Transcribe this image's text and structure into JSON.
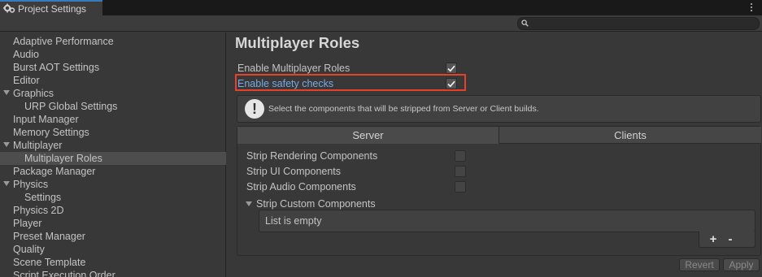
{
  "window": {
    "tab_title": "Project Settings"
  },
  "search": {
    "placeholder": "",
    "value": ""
  },
  "sidebar": {
    "items": [
      {
        "label": "Adaptive Performance"
      },
      {
        "label": "Audio"
      },
      {
        "label": "Burst AOT Settings"
      },
      {
        "label": "Editor"
      },
      {
        "label": "Graphics"
      },
      {
        "label": "URP Global Settings"
      },
      {
        "label": "Input Manager"
      },
      {
        "label": "Memory Settings"
      },
      {
        "label": "Multiplayer"
      },
      {
        "label": "Multiplayer Roles"
      },
      {
        "label": "Package Manager"
      },
      {
        "label": "Physics"
      },
      {
        "label": "Settings"
      },
      {
        "label": "Physics 2D"
      },
      {
        "label": "Player"
      },
      {
        "label": "Preset Manager"
      },
      {
        "label": "Quality"
      },
      {
        "label": "Scene Template"
      },
      {
        "label": "Script Execution Order"
      }
    ],
    "selected": "Multiplayer Roles"
  },
  "main": {
    "title": "Multiplayer Roles",
    "enable_roles": {
      "label": "Enable Multiplayer Roles",
      "checked": true
    },
    "safety_checks": {
      "label": "Enable safety checks",
      "checked": true
    },
    "help_text": "Select the components that will be stripped from Server or Client builds.",
    "tabs": {
      "server": "Server",
      "clients": "Clients",
      "active": "Server"
    },
    "strip": {
      "rendering": {
        "label": "Strip Rendering Components",
        "checked": false
      },
      "ui": {
        "label": "Strip UI Components",
        "checked": false
      },
      "audio": {
        "label": "Strip Audio Components",
        "checked": false
      },
      "custom": {
        "label": "Strip Custom Components"
      }
    },
    "list_empty": "List is empty",
    "add": "+",
    "remove": "-",
    "revert": "Revert",
    "apply": "Apply"
  },
  "colors": {
    "highlight": "#e8402a",
    "selected_bg": "#4d4d4d",
    "link_blue": "#7aa8e0"
  }
}
